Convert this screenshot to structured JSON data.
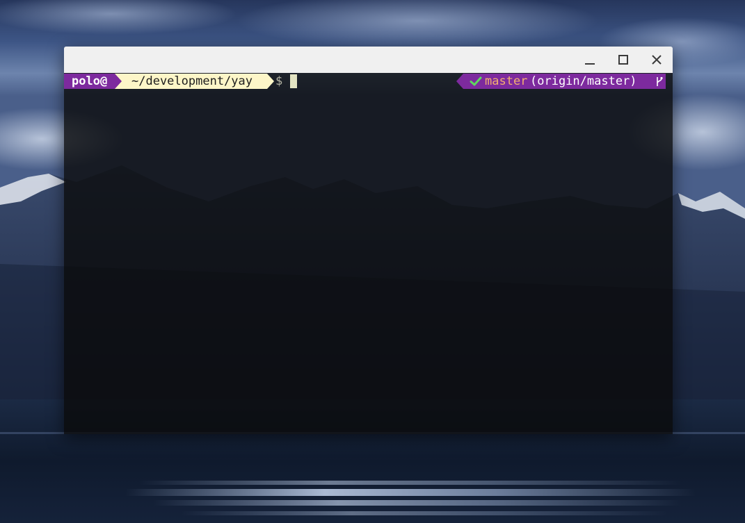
{
  "terminal": {
    "prompt": {
      "user": "polo@",
      "path": "~/development/yay",
      "symbol": "$"
    },
    "git": {
      "status_icon": "check-icon",
      "branch": "master",
      "remote": "(origin/master)",
      "branch_icon": "git-branch-icon"
    },
    "window_controls": {
      "minimize_icon": "minimize-icon",
      "maximize_icon": "maximize-icon",
      "close_icon": "close-icon"
    }
  },
  "colors": {
    "titlebar": "#f0f0f0",
    "segment_purple": "#7d2a9e",
    "segment_cream": "#fdf6c8",
    "branch_text": "#f3b070",
    "check_green": "#5fd75f"
  }
}
